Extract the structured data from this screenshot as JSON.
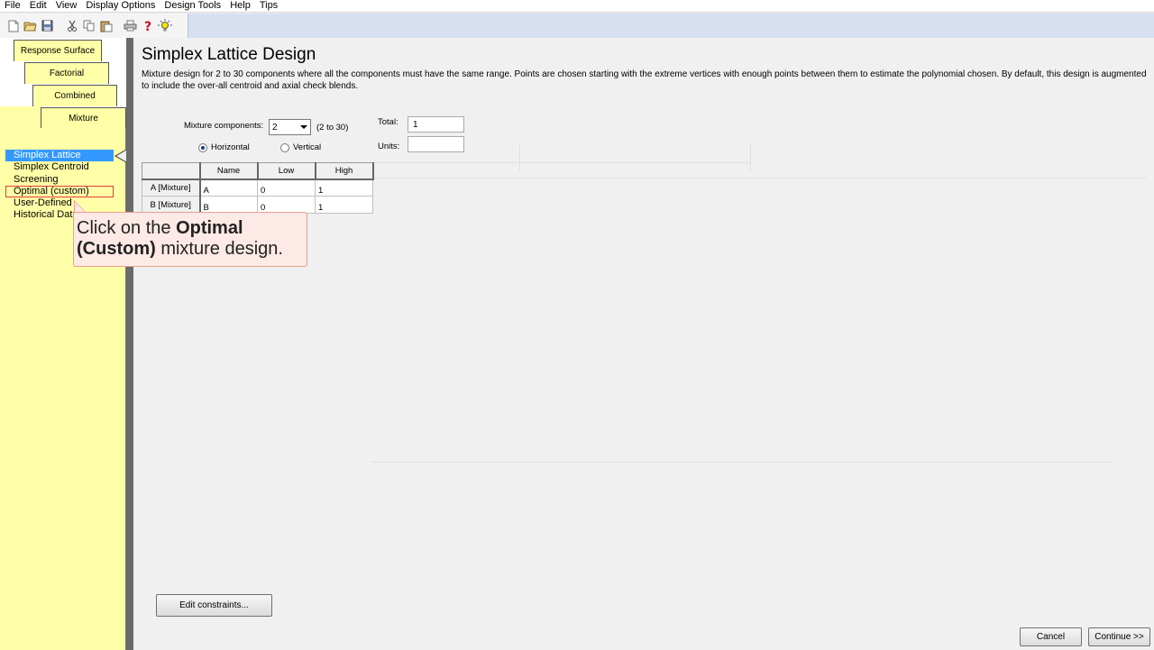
{
  "menubar": {
    "items": [
      "File",
      "Edit",
      "View",
      "Display Options",
      "Design Tools",
      "Help",
      "Tips"
    ]
  },
  "toolbar": {
    "icons": [
      "new-file-icon",
      "open-folder-icon",
      "save-icon",
      "cut-icon",
      "copy-icon",
      "paste-icon",
      "print-icon",
      "help-icon",
      "tip-bulb-icon"
    ]
  },
  "tabs": {
    "response_surface": "Response Surface",
    "factorial": "Factorial",
    "combined": "Combined",
    "mixture": "Mixture"
  },
  "design_list": {
    "items": [
      "Simplex Lattice",
      "Simplex Centroid",
      "Screening",
      "Optimal (custom)",
      "User-Defined",
      "Historical Data"
    ],
    "selected": "Simplex Lattice",
    "highlighted": "Optimal (custom)"
  },
  "main": {
    "title": "Simplex Lattice Design",
    "description": "Mixture design for 2 to 30 components where all the components must have the same range.  Points are chosen starting with the extreme vertices with enough points between them to estimate the polynomial chosen.  By default, this design is augmented to include the over-all centroid and axial check blends.",
    "mixture_components_label": "Mixture components:",
    "mixture_components_value": "2",
    "range_hint": "(2 to 30)",
    "total_label": "Total:",
    "total_value": "1",
    "units_label": "Units:",
    "units_value": "",
    "orientation": {
      "horizontal": "Horizontal",
      "vertical": "Vertical",
      "selected": "Horizontal"
    }
  },
  "grid": {
    "headers": [
      "Name",
      "Low",
      "High"
    ],
    "rows": [
      {
        "label": "A [Mixture]",
        "name": "A",
        "low": "0",
        "high": "1"
      },
      {
        "label": "B [Mixture]",
        "name": "B",
        "low": "0",
        "high": "1"
      }
    ]
  },
  "tooltip": {
    "prefix": "Click on the ",
    "bold": "Optimal (Custom)",
    "suffix": " mixture design."
  },
  "buttons": {
    "edit_constraints": "Edit constraints...",
    "cancel": "Cancel",
    "continue": "Continue >>"
  }
}
